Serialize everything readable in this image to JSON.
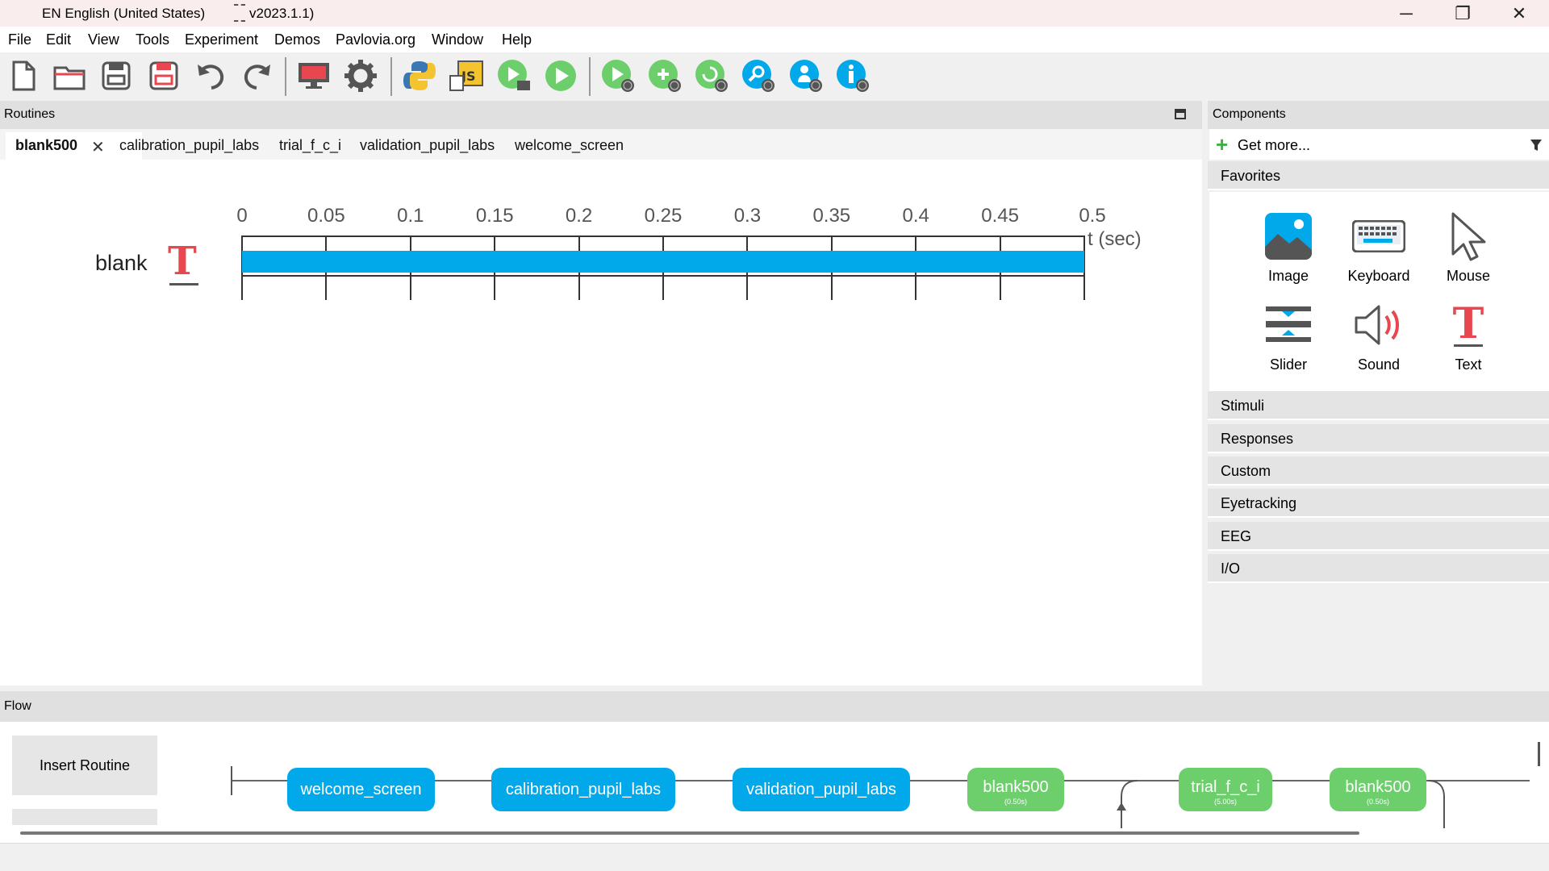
{
  "titlebar": {
    "language": "EN English (United States)",
    "version": "v2023.1.1)",
    "minimize": "─",
    "restore": "❐",
    "close": "✕"
  },
  "menu": [
    "File",
    "Edit",
    "View",
    "Tools",
    "Experiment",
    "Demos",
    "Pavlovia.org",
    "Window",
    "Help"
  ],
  "toolbar": {
    "icons": [
      "new-file-icon",
      "open-folder-icon",
      "save-icon",
      "save-as-icon",
      "undo-icon",
      "redo-icon",
      "monitor-icon",
      "gear-icon",
      "python-icon",
      "javascript-icon",
      "run-local-icon",
      "play-icon",
      "pilot-online-icon",
      "sync-online-icon",
      "globe-refresh-icon",
      "search-online-icon",
      "user-online-icon",
      "info-online-icon"
    ]
  },
  "routines": {
    "header": "Routines",
    "tabs": [
      "blank500",
      "calibration_pupil_labs",
      "trial_f_c_i",
      "validation_pupil_labs",
      "welcome_screen"
    ],
    "tab_close": "✕",
    "timeline": {
      "ticks": [
        "0",
        "0.05",
        "0.1",
        "0.15",
        "0.2",
        "0.25",
        "0.3",
        "0.35",
        "0.4",
        "0.45",
        "0.5"
      ],
      "unit": "t (sec)",
      "component_name": "blank",
      "component_icon": "T",
      "bar_start": 0,
      "bar_end": 0.5,
      "bar_color": "#02a9ea"
    }
  },
  "components": {
    "header": "Components",
    "get_more": "Get more...",
    "favorites_label": "Favorites",
    "favorites": [
      {
        "label": "Image",
        "icon": "image-icon"
      },
      {
        "label": "Keyboard",
        "icon": "keyboard-icon"
      },
      {
        "label": "Mouse",
        "icon": "mouse-cursor-icon"
      },
      {
        "label": "Slider",
        "icon": "slider-icon"
      },
      {
        "label": "Sound",
        "icon": "speaker-icon"
      },
      {
        "label": "Text",
        "icon": "text-icon"
      }
    ],
    "categories": [
      "Stimuli",
      "Responses",
      "Custom",
      "Eyetracking",
      "EEG",
      "I/O"
    ]
  },
  "flow": {
    "header": "Flow",
    "insert_routine": "Insert Routine",
    "nodes": [
      {
        "label": "welcome_screen",
        "color": "blue"
      },
      {
        "label": "calibration_pupil_labs",
        "color": "blue"
      },
      {
        "label": "validation_pupil_labs",
        "color": "blue"
      },
      {
        "label": "blank500",
        "duration": "(0.50s)",
        "color": "green"
      },
      {
        "label": "trial_f_c_i",
        "duration": "(5.00s)",
        "color": "green"
      },
      {
        "label": "blank500",
        "duration": "(0.50s)",
        "color": "green"
      }
    ]
  },
  "colors": {
    "routine_blue": "#02a9ea",
    "routine_green": "#6ccf6c",
    "text_icon_red": "#e8474f"
  }
}
